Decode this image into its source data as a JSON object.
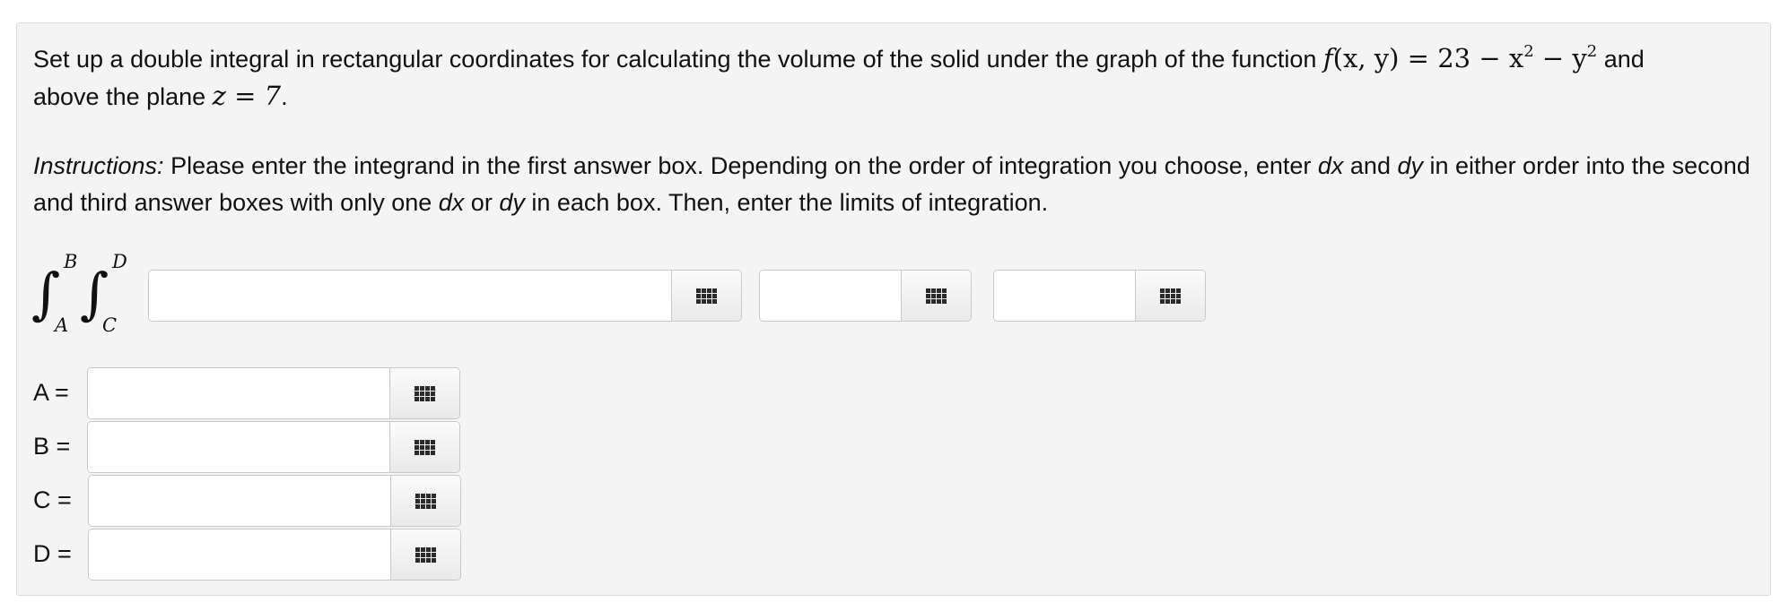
{
  "question": {
    "prefix": "Set up a double integral in rectangular coordinates for calculating the volume of the solid under the graph of the function ",
    "function_math": {
      "f": "f",
      "args": "(x, y)",
      "eq": " = 23 − x",
      "exp1": "2",
      "minus": " − y",
      "exp2": "2"
    },
    "and": " and",
    "line2_prefix": "above the plane ",
    "plane_math": "z = 7",
    "line2_suffix": "."
  },
  "instructions": {
    "label": "Instructions:",
    "text1": " Please enter the integrand in the first answer box. Depending on the order of integration you choose, enter ",
    "dx": "dx",
    "and": " and ",
    "dy": "dy",
    "text2": " in either order into the second and third answer boxes with only one ",
    "dx2": "dx",
    "or": " or ",
    "dy2": "dy",
    "text3": " in each box. Then, enter the limits of integration."
  },
  "integral": {
    "sign": "∫",
    "outer_upper": "B",
    "outer_lower": "A",
    "inner_upper": "D",
    "inner_lower": "C"
  },
  "answers": {
    "integrand_value": "",
    "differential1_value": "",
    "differential2_value": ""
  },
  "limits": [
    {
      "label": "A =",
      "value": ""
    },
    {
      "label": "B =",
      "value": ""
    },
    {
      "label": "C =",
      "value": ""
    },
    {
      "label": "D =",
      "value": ""
    }
  ],
  "icons": {
    "keypad": "keypad-icon"
  }
}
